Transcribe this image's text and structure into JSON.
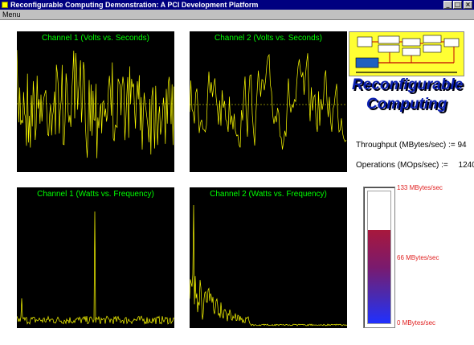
{
  "window": {
    "title": "Reconfigurable Computing Demonstration:  A PCI Development Platform",
    "minimize_glyph": "_",
    "maximize_glyph": "□",
    "close_glyph": "×"
  },
  "menu": {
    "label": "Menu"
  },
  "scopes": {
    "ch1_time": {
      "title": "Channel 1 (Volts vs. Seconds)"
    },
    "ch2_time": {
      "title": "Channel 2 (Volts vs. Seconds)"
    },
    "ch1_freq": {
      "title": "Channel 1 (Watts vs. Frequency)"
    },
    "ch2_freq": {
      "title": "Channel 2 (Watts vs. Frequency)"
    }
  },
  "logo": {
    "line1": "Reconfigurable",
    "line2": "Computing"
  },
  "stats": {
    "throughput_label": "Throughput (MBytes/sec) :=",
    "throughput_value": "94",
    "operations_label": "Operations (MOps/sec) :=",
    "operations_value": "1240"
  },
  "meter": {
    "max_label": "133 MBytes/sec",
    "mid_label": "66  MBytes/sec",
    "min_label": "0  MBytes/sec",
    "level_fraction": 0.707
  },
  "colors": {
    "trace": "#ffff00",
    "scope_title": "#00ff00",
    "meter_label": "#e02020"
  }
}
